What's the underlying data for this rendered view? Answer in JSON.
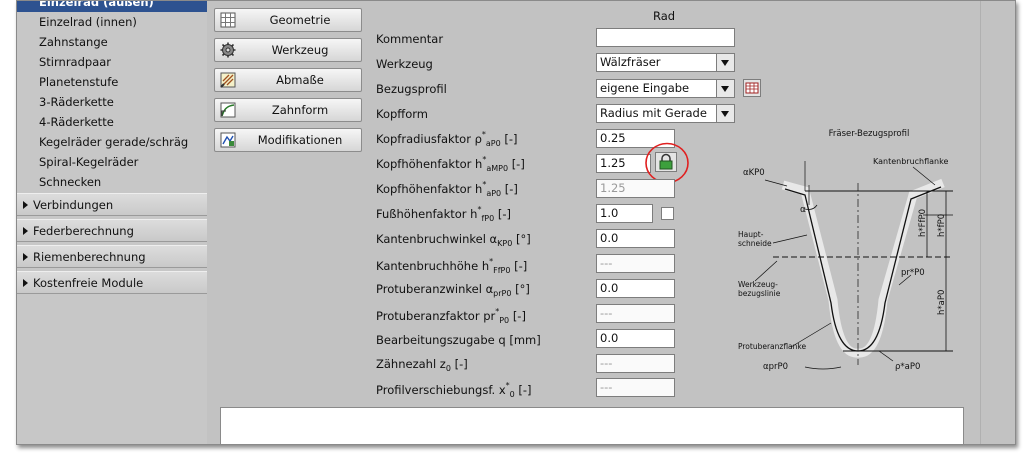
{
  "sidebar": {
    "items": [
      {
        "label": "Einzelrad (außen)",
        "active": true
      },
      {
        "label": "Einzelrad (innen)"
      },
      {
        "label": "Zahnstange"
      },
      {
        "label": "Stirnradpaar"
      },
      {
        "label": "Planetenstufe"
      },
      {
        "label": "3-Räderkette"
      },
      {
        "label": "4-Räderkette"
      },
      {
        "label": "Kegelräder gerade/schräg"
      },
      {
        "label": "Spiral-Kegelräder"
      },
      {
        "label": "Schnecken"
      }
    ],
    "groups": [
      {
        "label": "Verbindungen"
      },
      {
        "label": "Federberechnung"
      },
      {
        "label": "Riemenberechnung"
      },
      {
        "label": "Kostenfreie Module"
      }
    ]
  },
  "buttons": [
    {
      "label": "Geometrie",
      "icon": "grid-icon"
    },
    {
      "label": "Werkzeug",
      "icon": "gear-tool-icon"
    },
    {
      "label": "Abmaße",
      "icon": "measure-icon"
    },
    {
      "label": "Zahnform",
      "icon": "tooth-shape-icon"
    },
    {
      "label": "Modifikationen",
      "icon": "modification-icon"
    }
  ],
  "section_title": "Rad",
  "form": {
    "kommentar": {
      "label": "Kommentar",
      "value": ""
    },
    "werkzeug": {
      "label": "Werkzeug",
      "value": "Wälzfräser"
    },
    "bezugsprofil": {
      "label": "Bezugsprofil",
      "value": "eigene Eingabe"
    },
    "kopfform": {
      "label": "Kopfform",
      "value": "Radius mit Gerade"
    },
    "kopfradiusfaktor": {
      "label": "Kopfradiusfaktor ρ",
      "sub": "aP0",
      "unit": "[-]",
      "value": "0.25"
    },
    "kopfhoehenfaktor_amp": {
      "label": "Kopfhöhenfaktor h",
      "sub": "aMP0",
      "unit": "[-]",
      "value": "1.25"
    },
    "kopfhoehenfaktor_ap": {
      "label": "Kopfhöhenfaktor h",
      "sub": "aP0",
      "unit": "[-]",
      "value": "1.25"
    },
    "fusshoehenfaktor": {
      "label": "Fußhöhenfaktor h",
      "sub": "fP0",
      "unit": "[-]",
      "value": "1.0"
    },
    "kantenbruchwinkel": {
      "label": "Kantenbruchwinkel α",
      "sub": "KP0",
      "unit": "[°]",
      "value": "0.0"
    },
    "kantenbruchhoehe": {
      "label": "Kantenbruchhöhe h",
      "sub": "FfP0",
      "unit": "[-]",
      "value": "---"
    },
    "protuberanzwinkel": {
      "label": "Protuberanzwinkel α",
      "sub": "prP0",
      "unit": "[°]",
      "value": "0.0"
    },
    "protuberanzfaktor": {
      "label": "Protuberanzfaktor pr",
      "sub": "P0",
      "unit": "[-]",
      "value": "---"
    },
    "bearbeitungszugabe": {
      "label": "Bearbeitungszugabe q [mm]",
      "value": "0.0"
    },
    "zaehnezahl": {
      "label": "Zähnezahl z",
      "sub": "0",
      "unit": "[-]",
      "value": "---"
    },
    "profilverschiebung": {
      "label": "Profilverschiebungsf. x",
      "sub": "0",
      "unit": "[-]",
      "value": "---"
    }
  },
  "diagram": {
    "title": "Fräser-Bezugsprofil",
    "labels": {
      "kantenbruchflanke": "Kantenbruchflanke",
      "alpha_kp0": "αKP0",
      "alpha": "α",
      "hauptschneide": "Haupt-\nschneide",
      "werkzeugbezugslinie": "Werkzeug-\nbezugslinie",
      "protuberanzflanke": "Protuberanzflanke",
      "alpha_prp0": "αprP0",
      "rho_ap0": "ρ*aP0",
      "pr_p0": "pr*P0",
      "h_ffp0": "h*FfP0",
      "h_fp0": "h*fP0",
      "h_ap0": "h*aP0"
    }
  },
  "colors": {
    "sidebar_active": "#2d5290",
    "highlight_circle": "#e02020"
  }
}
